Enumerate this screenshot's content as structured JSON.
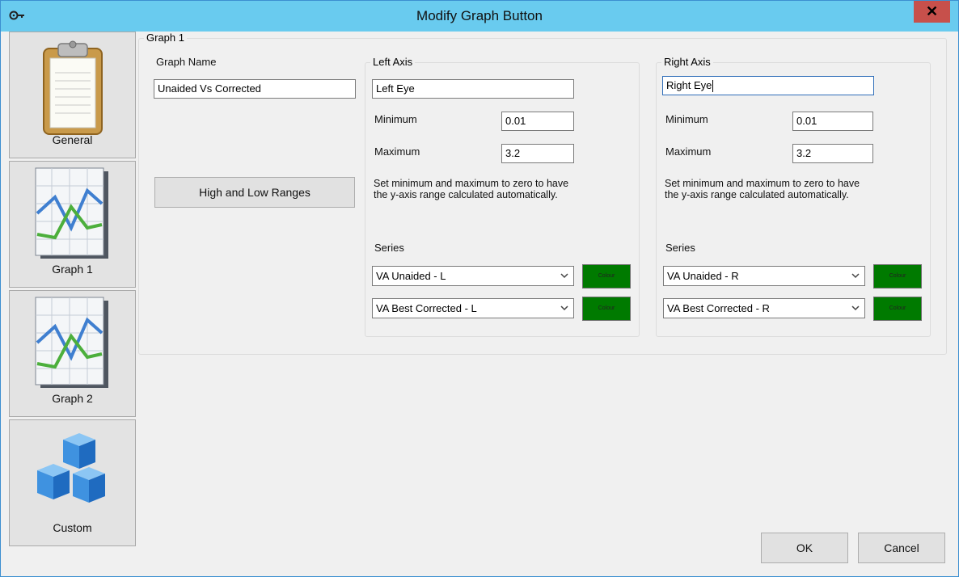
{
  "window": {
    "title": "Modify Graph Button",
    "close_glyph": "✕",
    "app_icon": "key-icon"
  },
  "nav": [
    {
      "label": "General",
      "icon": "clipboard-icon"
    },
    {
      "label": "Graph 1",
      "icon": "line-chart-icon"
    },
    {
      "label": "Graph 2",
      "icon": "line-chart-icon"
    },
    {
      "label": "Custom",
      "icon": "cubes-icon"
    }
  ],
  "graph_group": {
    "title": "Graph 1",
    "graph_name_label": "Graph Name",
    "graph_name_value": "Unaided Vs Corrected",
    "ranges_button": "High and Low Ranges"
  },
  "left_axis": {
    "title": "Left Axis",
    "name_value": "Left Eye",
    "minimum_label": "Minimum",
    "minimum_value": "0.01",
    "maximum_label": "Maximum",
    "maximum_value": "3.2",
    "hint": "Set minimum and maximum to zero to have the y-axis range calculated automatically.",
    "series_label": "Series",
    "series": [
      {
        "value": "VA Unaided - L",
        "colour_label": "Colour",
        "colour": "#007a00"
      },
      {
        "value": "VA Best Corrected - L",
        "colour_label": "Colour",
        "colour": "#007a00"
      }
    ]
  },
  "right_axis": {
    "title": "Right Axis",
    "name_value": "Right Eye",
    "minimum_label": "Minimum",
    "minimum_value": "0.01",
    "maximum_label": "Maximum",
    "maximum_value": "3.2",
    "hint": "Set minimum and maximum to zero to have the y-axis range calculated automatically.",
    "series_label": "Series",
    "series": [
      {
        "value": "VA Unaided - R",
        "colour_label": "Colour",
        "colour": "#007a00"
      },
      {
        "value": "VA Best Corrected - R",
        "colour_label": "Colour",
        "colour": "#007a00"
      }
    ]
  },
  "footer": {
    "ok": "OK",
    "cancel": "Cancel"
  },
  "colors": {
    "titlebar": "#69cbef",
    "close": "#c7504b",
    "series_colour": "#007a00"
  }
}
